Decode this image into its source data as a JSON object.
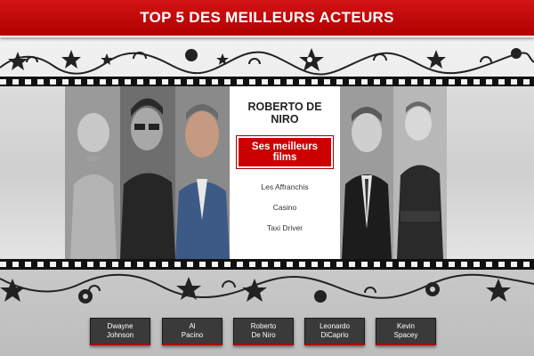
{
  "header": {
    "title": "TOP 5 DES MEILLEURS ACTEURS"
  },
  "colors": {
    "accent": "#cc0000",
    "strip": "#111111",
    "button": "#3a3a3a"
  },
  "photos": [
    {
      "name": "dwayne-johnson-photo",
      "icon": "portrait-photo"
    },
    {
      "name": "al-pacino-photo",
      "icon": "portrait-photo"
    },
    {
      "name": "robert-de-niro-photo",
      "icon": "portrait-photo"
    },
    {
      "name": "leonardo-dicaprio-photo",
      "icon": "portrait-photo"
    },
    {
      "name": "kevin-spacey-photo",
      "icon": "portrait-photo"
    }
  ],
  "detail": {
    "actor_name": "ROBERTO DE NIRO",
    "films_heading": "Ses meilleurs films",
    "films": [
      "Les Affranchis",
      "Casino",
      "Taxi Driver"
    ]
  },
  "nav": {
    "buttons": [
      {
        "line1": "Dwayne",
        "line2": "Johnson"
      },
      {
        "line1": "Al",
        "line2": "Pacino"
      },
      {
        "line1": "Roberto",
        "line2": "De Niro"
      },
      {
        "line1": "Leonardo",
        "line2": "DiCaprio"
      },
      {
        "line1": "Kevin",
        "line2": "Spacey"
      }
    ]
  },
  "decor": {
    "top_ornament": "stars-swirls-ornament",
    "bottom_ornament": "stars-swirls-ornament"
  }
}
